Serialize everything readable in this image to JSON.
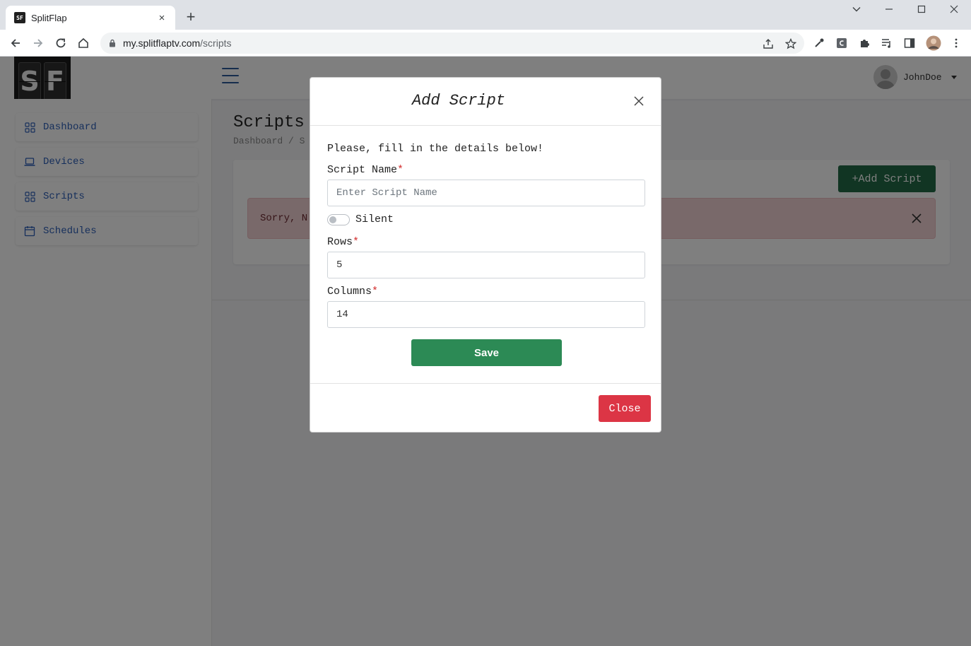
{
  "browser": {
    "tab_title": "SplitFlap",
    "tab_close": "×",
    "new_tab": "+",
    "favicon_text": "SF",
    "url_host": "my.splitflaptv.com",
    "url_path": "/scripts"
  },
  "header": {
    "logo_letters": [
      "S",
      "F"
    ],
    "username": "JohnDoe"
  },
  "sidebar": {
    "items": [
      {
        "label": "Dashboard",
        "icon": "grid-icon"
      },
      {
        "label": "Devices",
        "icon": "laptop-icon"
      },
      {
        "label": "Scripts",
        "icon": "grid-icon"
      },
      {
        "label": "Schedules",
        "icon": "calendar-icon"
      }
    ]
  },
  "page": {
    "title": "Scripts",
    "breadcrumb": "Dashboard / S",
    "add_button": "+Add Script",
    "alert_text": "Sorry, N"
  },
  "modal": {
    "title": "Add Script",
    "intro": "Please, fill in the details below!",
    "script_name_label": "Script Name",
    "script_name_placeholder": "Enter Script Name",
    "required_mark": "*",
    "silent_label": "Silent",
    "silent_on": false,
    "rows_label": "Rows",
    "rows_value": "5",
    "columns_label": "Columns",
    "columns_value": "14",
    "save_label": "Save",
    "close_label": "Close"
  },
  "colors": {
    "primary_green": "#2c8a55",
    "dark_green": "#236b46",
    "danger_red": "#dc3545",
    "link_blue": "#2d5fb8"
  }
}
